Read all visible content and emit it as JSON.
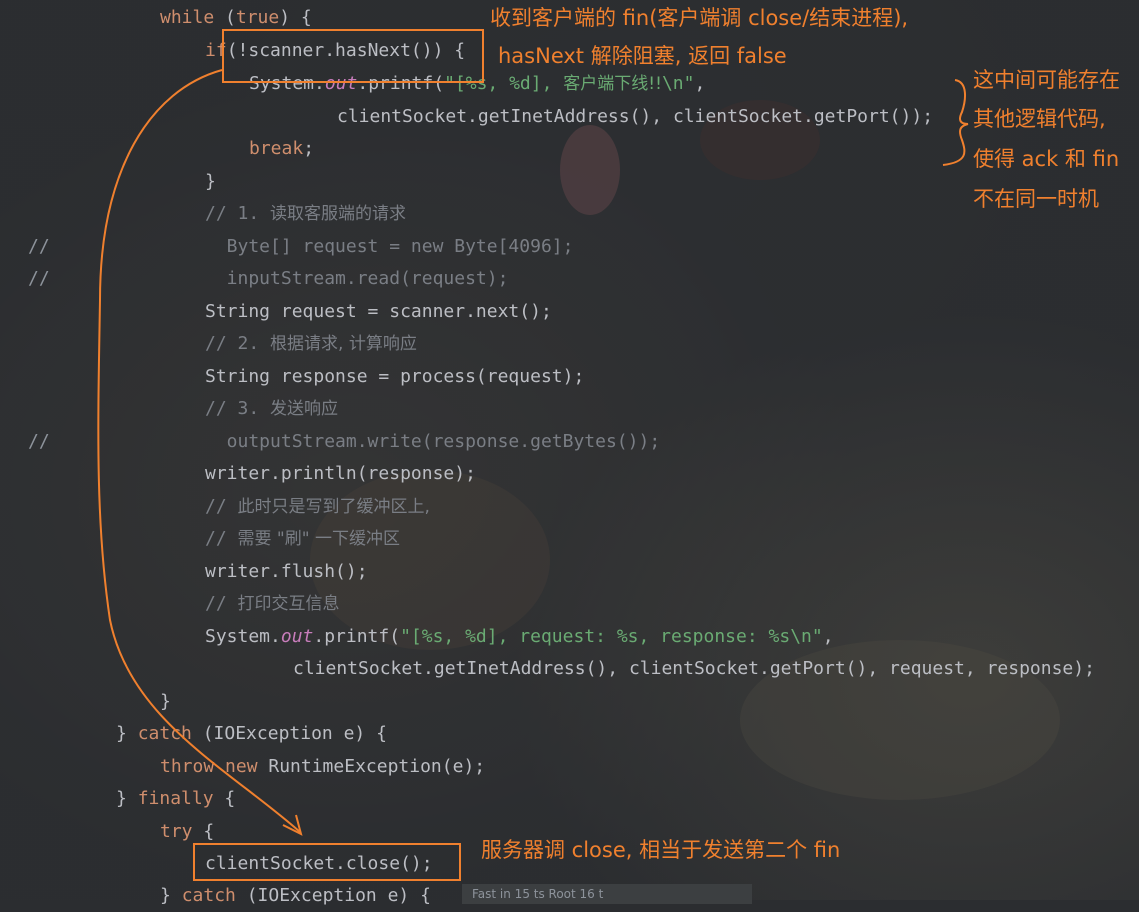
{
  "code_lines": [
    {
      "gutter": "",
      "tokens": [
        [
          "kw",
          "while "
        ],
        [
          "id",
          "("
        ],
        [
          "kw",
          "true"
        ],
        [
          "id",
          ") {"
        ]
      ]
    },
    {
      "gutter": "",
      "tokens": [
        [
          "kw",
          "if"
        ],
        [
          "id",
          "(!scanner.hasNext()) {"
        ]
      ]
    },
    {
      "gutter": "",
      "tokens": [
        [
          "id",
          "System."
        ],
        [
          "fld",
          "out"
        ],
        [
          "id",
          ".printf("
        ],
        [
          "str",
          "\"[%s, %d], "
        ],
        [
          "str-cn",
          "客户端下线!!"
        ],
        [
          "str",
          "\\n\""
        ],
        [
          "id",
          ","
        ]
      ]
    },
    {
      "gutter": "",
      "tokens": [
        [
          "id",
          "clientSocket.getInetAddress(), clientSocket.getPort());"
        ]
      ]
    },
    {
      "gutter": "",
      "tokens": [
        [
          "kw",
          "break"
        ],
        [
          "id",
          ";"
        ]
      ]
    },
    {
      "gutter": "",
      "tokens": [
        [
          "id",
          "}"
        ]
      ]
    },
    {
      "gutter": "",
      "tokens": [
        [
          "cmt",
          "// 1. "
        ],
        [
          "cmt-cn",
          "读取客服端的请求"
        ]
      ]
    },
    {
      "gutter": "//",
      "tokens": [
        [
          "cmt",
          "  Byte[] request = new Byte[4096];"
        ]
      ]
    },
    {
      "gutter": "//",
      "tokens": [
        [
          "cmt",
          "  inputStream.read(request);"
        ]
      ]
    },
    {
      "gutter": "",
      "tokens": [
        [
          "id",
          "String request = scanner.next();"
        ]
      ]
    },
    {
      "gutter": "",
      "tokens": [
        [
          "cmt",
          "// 2. "
        ],
        [
          "cmt-cn",
          "根据请求, 计算响应"
        ]
      ]
    },
    {
      "gutter": "",
      "tokens": [
        [
          "id",
          "String response = process(request);"
        ]
      ]
    },
    {
      "gutter": "",
      "tokens": [
        [
          "cmt",
          "// 3. "
        ],
        [
          "cmt-cn",
          "发送响应"
        ]
      ]
    },
    {
      "gutter": "//",
      "tokens": [
        [
          "cmt",
          "  outputStream.write(response.getBytes());"
        ]
      ]
    },
    {
      "gutter": "",
      "tokens": [
        [
          "id",
          "writer.println(response);"
        ]
      ]
    },
    {
      "gutter": "",
      "tokens": [
        [
          "cmt",
          "// "
        ],
        [
          "cmt-cn",
          "此时只是写到了缓冲区上,"
        ]
      ]
    },
    {
      "gutter": "",
      "tokens": [
        [
          "cmt",
          "// "
        ],
        [
          "cmt-cn",
          "需要 \"刷\" 一下缓冲区"
        ]
      ]
    },
    {
      "gutter": "",
      "tokens": [
        [
          "id",
          "writer.flush();"
        ]
      ]
    },
    {
      "gutter": "",
      "tokens": [
        [
          "cmt",
          "// "
        ],
        [
          "cmt-cn",
          "打印交互信息"
        ]
      ]
    },
    {
      "gutter": "",
      "tokens": [
        [
          "id",
          "System."
        ],
        [
          "fld",
          "out"
        ],
        [
          "id",
          ".printf("
        ],
        [
          "str",
          "\"[%s, %d], request: %s, response: %s\\n\""
        ],
        [
          "id",
          ","
        ]
      ]
    },
    {
      "gutter": "",
      "tokens": [
        [
          "id",
          "clientSocket.getInetAddress(), clientSocket.getPort(), request, response);"
        ]
      ]
    },
    {
      "gutter": "",
      "tokens": [
        [
          "id",
          "}"
        ]
      ]
    },
    {
      "gutter": "",
      "tokens": [
        [
          "id",
          "} "
        ],
        [
          "kw",
          "catch"
        ],
        [
          "id",
          " (IOException e) {"
        ]
      ]
    },
    {
      "gutter": "",
      "tokens": [
        [
          "kw",
          "throw new "
        ],
        [
          "id",
          "RuntimeException(e);"
        ]
      ]
    },
    {
      "gutter": "",
      "tokens": [
        [
          "id",
          "} "
        ],
        [
          "kw",
          "finally"
        ],
        [
          "id",
          " {"
        ]
      ]
    },
    {
      "gutter": "",
      "tokens": [
        [
          "kw",
          "try"
        ],
        [
          "id",
          " {"
        ]
      ]
    },
    {
      "gutter": "",
      "tokens": [
        [
          "id",
          "clientSocket.close();"
        ]
      ]
    },
    {
      "gutter": "",
      "tokens": [
        [
          "id",
          "} "
        ],
        [
          "kw",
          "catch"
        ],
        [
          "id",
          " (IOException e) {"
        ]
      ]
    }
  ],
  "annotations": {
    "fin_received_line1": "收到客户端的 fin(客户端调 close/结束进程),",
    "fin_received_line2": "hasNext 解除阻塞, 返回 false",
    "gap_note_line1": "这中间可能存在",
    "gap_note_line2": "其他逻辑代码,",
    "gap_note_line3": "使得 ack 和 fin",
    "gap_note_line4": "不在同一时机",
    "server_close": "服务器调 close, 相当于发送第二个 fin"
  },
  "status_hint": "Fast in 15 ts  Root 16 t",
  "colors": {
    "annotation": "#f0802e",
    "keyword": "#cf8e6d",
    "identifier": "#bcbec4",
    "string": "#6aab73",
    "comment": "#7a7e85",
    "field": "#c77dbb"
  }
}
